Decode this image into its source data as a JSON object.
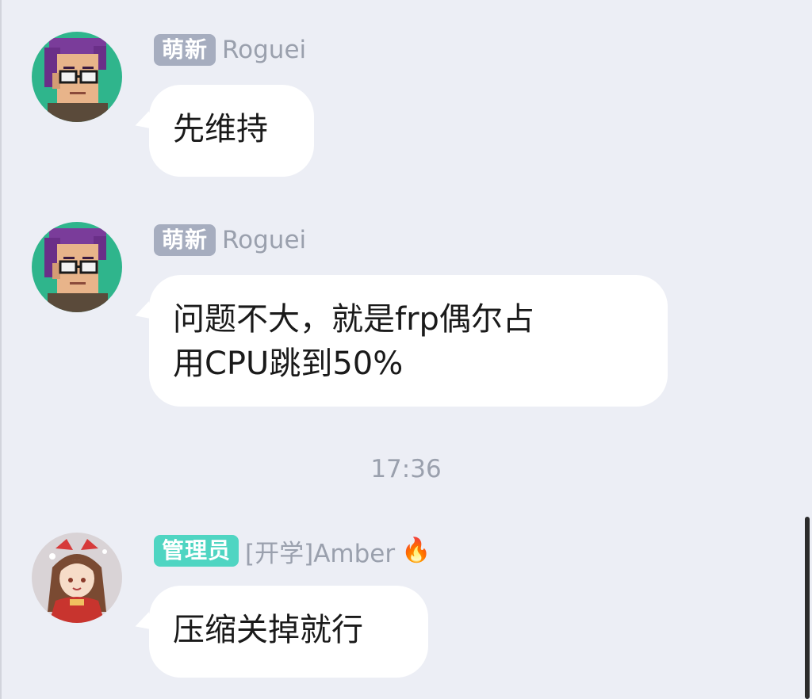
{
  "messages": [
    {
      "badge": "萌新",
      "badge_color": "#a6adbf",
      "sender": "Roguei",
      "avatar_icon": "pixel-art-man-with-glasses",
      "lines": [
        "先维持"
      ]
    },
    {
      "badge": "萌新",
      "badge_color": "#a6adbf",
      "sender": "Roguei",
      "avatar_icon": "pixel-art-man-with-glasses",
      "lines": [
        "问题不大，就是frp偶尔占",
        "用CPU跳到50%"
      ]
    },
    {
      "badge": "管理员",
      "badge_color": "#4fd5c2",
      "sender": "[开学]Amber",
      "sender_emoji": "🔥",
      "avatar_icon": "anime-girl-red-bow",
      "lines": [
        "压缩关掉就行"
      ]
    }
  ],
  "timestamp": "17:36",
  "colors": {
    "background": "#eceef5",
    "bubble": "#ffffff",
    "name_text": "#9aa0ad"
  }
}
